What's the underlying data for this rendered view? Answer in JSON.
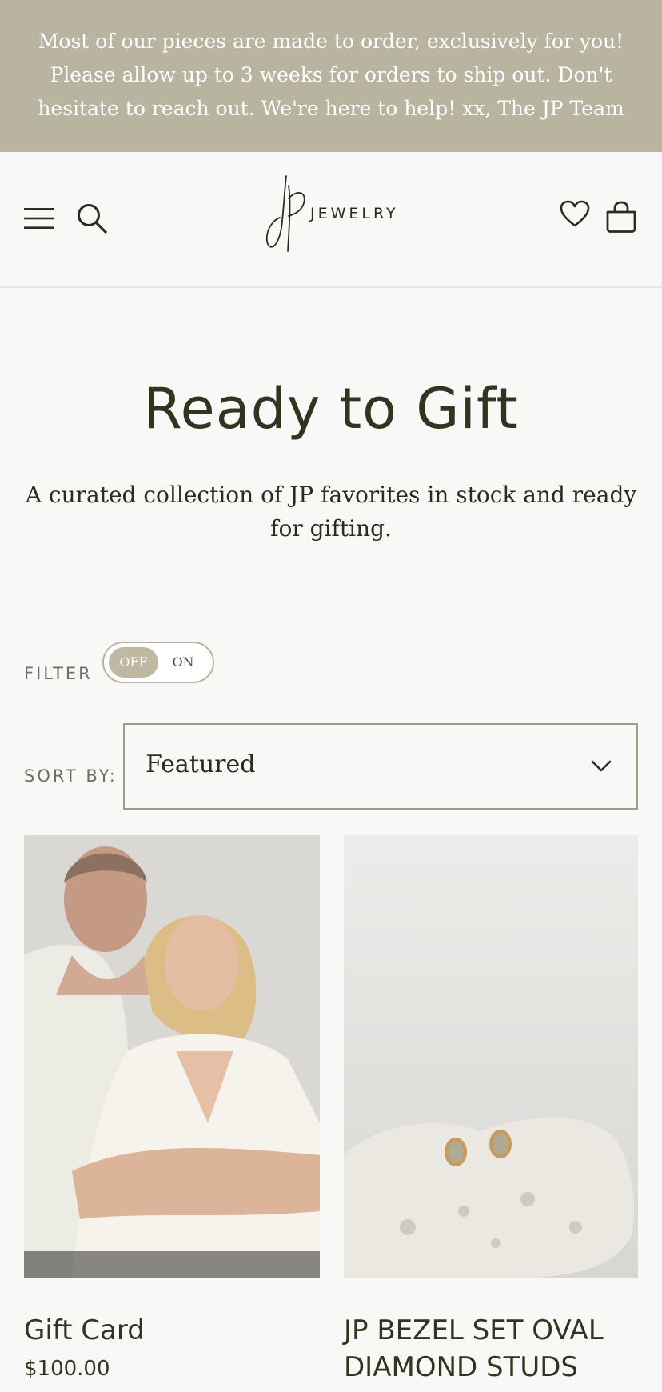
{
  "announcement": {
    "text": "Most of our pieces are made to order, exclusively for you! Please allow up to 3 weeks for orders to ship out. Don't hesitate to reach out. We're here to help! xx, The JP Team"
  },
  "header": {
    "logo_text": "JEWELRY",
    "icons": [
      "menu-icon",
      "search-icon",
      "heart-icon",
      "bag-icon"
    ]
  },
  "collection": {
    "title": "Ready to Gift",
    "description": "A curated collection of JP favorites in stock and ready for gifting."
  },
  "filter": {
    "label": "FILTER",
    "toggle_off": "OFF",
    "toggle_on": "ON",
    "state": "off"
  },
  "sort": {
    "label": "SORT BY:",
    "value": "Featured"
  },
  "products": [
    {
      "title": "Gift Card",
      "price": "$100.00"
    },
    {
      "title": "JP BEZEL SET OVAL DIAMOND STUDS",
      "price": ""
    }
  ],
  "colors": {
    "announcement_bg": "#b9b4a0",
    "page_bg": "#f8f8f6",
    "accent": "#a39b85",
    "text": "#2b2b22"
  }
}
